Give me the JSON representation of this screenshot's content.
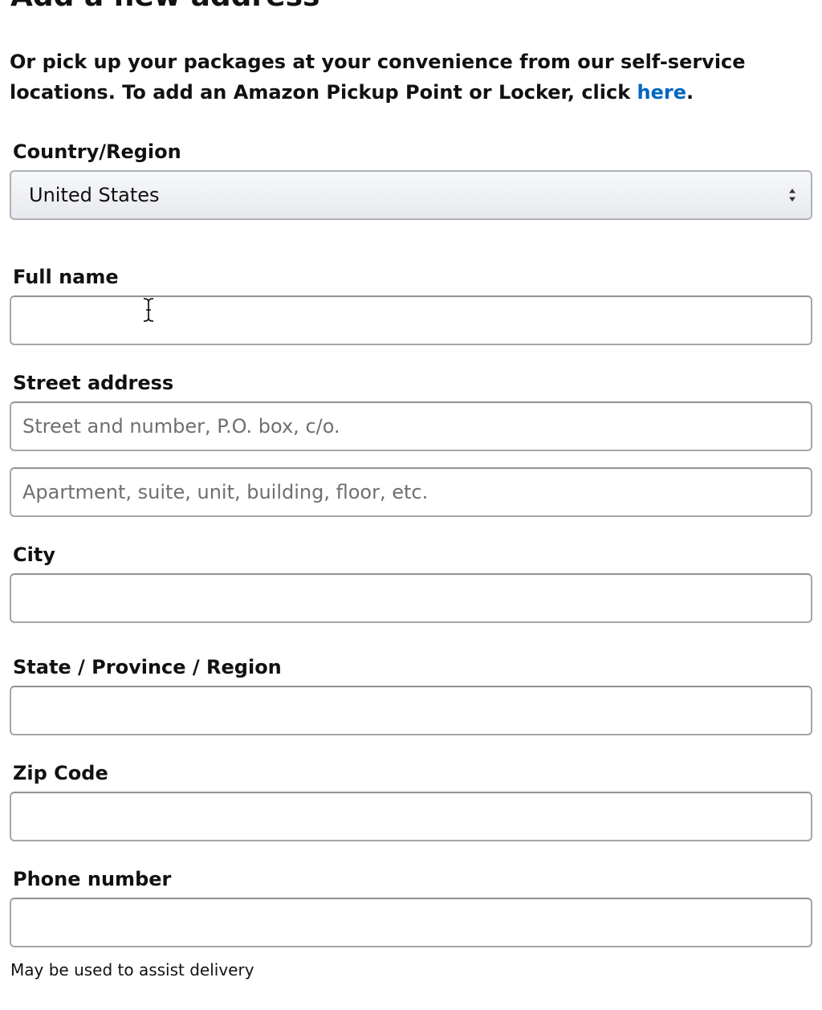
{
  "header": {
    "title": "Add a new address"
  },
  "intro": {
    "text_before_link": "Or pick up your packages at your convenience from our self-service locations. To add an Amazon Pickup Point or Locker, click ",
    "link_text": "here",
    "text_after_link": "."
  },
  "form": {
    "country": {
      "label": "Country/Region",
      "selected_value": "United States"
    },
    "full_name": {
      "label": "Full name",
      "value": ""
    },
    "street": {
      "label": "Street address",
      "line1_placeholder": "Street and number, P.O. box, c/o.",
      "line2_placeholder": "Apartment, suite, unit, building, floor, etc."
    },
    "city": {
      "label": "City",
      "value": ""
    },
    "state": {
      "label": "State / Province / Region",
      "value": ""
    },
    "zip": {
      "label": "Zip Code",
      "value": ""
    },
    "phone": {
      "label": "Phone number",
      "value": "",
      "hint": "May be used to assist delivery"
    }
  },
  "colors": {
    "link": "#0066c0",
    "text": "#111111",
    "border": "#a6a6a6",
    "placeholder": "#6f6f6f"
  },
  "icons": {
    "select_arrows": "up-down-arrows-icon",
    "cursor": "text-cursor-icon"
  }
}
